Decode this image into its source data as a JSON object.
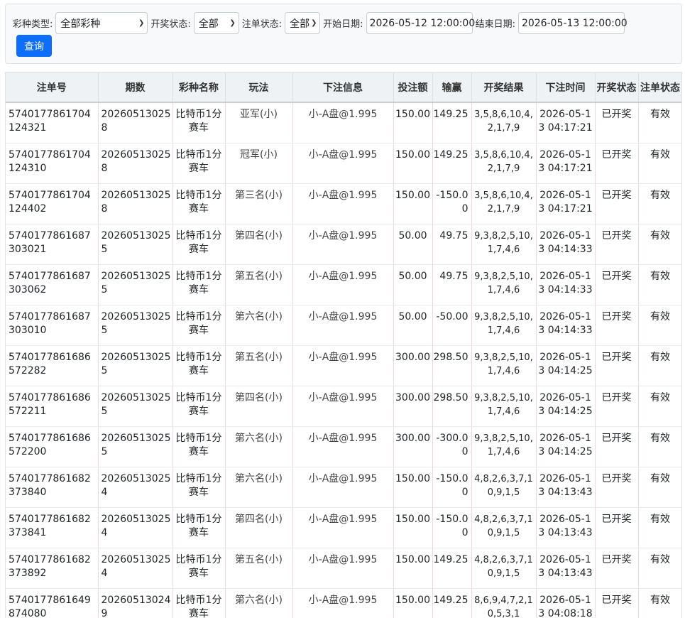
{
  "filters": {
    "lottery_type_label": "彩种类型:",
    "lottery_type_value": "全部彩种",
    "draw_status_label": "开奖状态:",
    "draw_status_value": "全部",
    "bet_status_label": "注单状态:",
    "bet_status_value": "全部",
    "start_date_label": "开始日期:",
    "start_date_value": "2026-05-12 12:00:00",
    "end_date_label": "结束日期:",
    "end_date_value": "2026-05-13 12:00:00",
    "query_button": "查询"
  },
  "table": {
    "headers": [
      "注单号",
      "期数",
      "彩种名称",
      "玩法",
      "下注信息",
      "投注额",
      "输赢",
      "开奖结果",
      "下注时间",
      "开奖状态",
      "注单状态"
    ],
    "rows": [
      [
        "5740177861704124321",
        "202605130258",
        "比特币1分赛车",
        "亚军(小)",
        "小-A盘@1.995",
        "150.00",
        "149.25",
        "3,5,8,6,10,4,2,1,7,9",
        "2026-05-13 04:17:21",
        "已开奖",
        "有效"
      ],
      [
        "5740177861704124310",
        "202605130258",
        "比特币1分赛车",
        "冠军(小)",
        "小-A盘@1.995",
        "150.00",
        "149.25",
        "3,5,8,6,10,4,2,1,7,9",
        "2026-05-13 04:17:21",
        "已开奖",
        "有效"
      ],
      [
        "5740177861704124402",
        "202605130258",
        "比特币1分赛车",
        "第三名(小)",
        "小-A盘@1.995",
        "150.00",
        "-150.00",
        "3,5,8,6,10,4,2,1,7,9",
        "2026-05-13 04:17:21",
        "已开奖",
        "有效"
      ],
      [
        "5740177861687303021",
        "202605130255",
        "比特币1分赛车",
        "第四名(小)",
        "小-A盘@1.995",
        "50.00",
        "49.75",
        "9,3,8,2,5,10,1,7,4,6",
        "2026-05-13 04:14:33",
        "已开奖",
        "有效"
      ],
      [
        "5740177861687303062",
        "202605130255",
        "比特币1分赛车",
        "第五名(小)",
        "小-A盘@1.995",
        "50.00",
        "49.75",
        "9,3,8,2,5,10,1,7,4,6",
        "2026-05-13 04:14:33",
        "已开奖",
        "有效"
      ],
      [
        "5740177861687303010",
        "202605130255",
        "比特币1分赛车",
        "第六名(小)",
        "小-A盘@1.995",
        "50.00",
        "-50.00",
        "9,3,8,2,5,10,1,7,4,6",
        "2026-05-13 04:14:33",
        "已开奖",
        "有效"
      ],
      [
        "5740177861686572282",
        "202605130255",
        "比特币1分赛车",
        "第五名(小)",
        "小-A盘@1.995",
        "300.00",
        "298.50",
        "9,3,8,2,5,10,1,7,4,6",
        "2026-05-13 04:14:25",
        "已开奖",
        "有效"
      ],
      [
        "5740177861686572211",
        "202605130255",
        "比特币1分赛车",
        "第四名(小)",
        "小-A盘@1.995",
        "300.00",
        "298.50",
        "9,3,8,2,5,10,1,7,4,6",
        "2026-05-13 04:14:25",
        "已开奖",
        "有效"
      ],
      [
        "5740177861686572200",
        "202605130255",
        "比特币1分赛车",
        "第六名(小)",
        "小-A盘@1.995",
        "300.00",
        "-300.00",
        "9,3,8,2,5,10,1,7,4,6",
        "2026-05-13 04:14:25",
        "已开奖",
        "有效"
      ],
      [
        "5740177861682373840",
        "202605130254",
        "比特币1分赛车",
        "第六名(小)",
        "小-A盘@1.995",
        "150.00",
        "-150.00",
        "4,8,2,6,3,7,10,9,1,5",
        "2026-05-13 04:13:43",
        "已开奖",
        "有效"
      ],
      [
        "5740177861682373841",
        "202605130254",
        "比特币1分赛车",
        "第四名(小)",
        "小-A盘@1.995",
        "150.00",
        "-150.00",
        "4,8,2,6,3,7,10,9,1,5",
        "2026-05-13 04:13:43",
        "已开奖",
        "有效"
      ],
      [
        "5740177861682373892",
        "202605130254",
        "比特币1分赛车",
        "第五名(小)",
        "小-A盘@1.995",
        "150.00",
        "149.25",
        "4,8,2,6,3,7,10,9,1,5",
        "2026-05-13 04:13:43",
        "已开奖",
        "有效"
      ],
      [
        "5740177861649874080",
        "202605130249",
        "比特币1分赛车",
        "第六名(小)",
        "小-A盘@1.995",
        "150.00",
        "149.25",
        "8,6,9,4,7,2,10,5,3,1",
        "2026-05-13 04:08:18",
        "已开奖",
        "有效"
      ]
    ]
  },
  "colors": {
    "primary": "#0d6efd",
    "header_bg": "#eef2f5",
    "panel_bg": "#f8f9fa"
  }
}
